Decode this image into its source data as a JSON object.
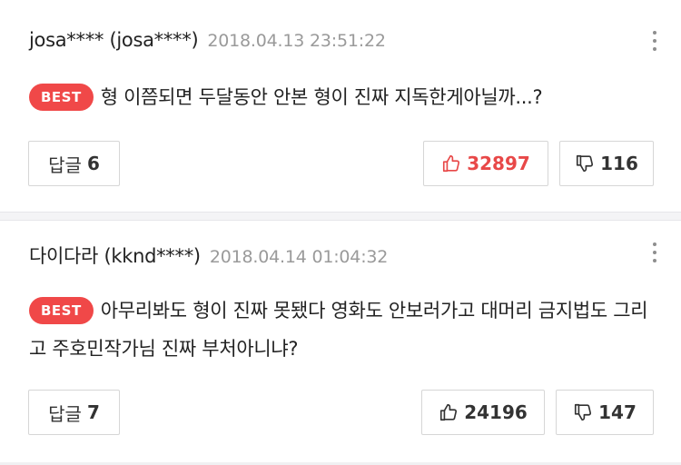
{
  "comments": [
    {
      "author": "josa**** (josa****)",
      "date": "2018.04.13 23:51:22",
      "badge": "BEST",
      "text": "형 이쯤되면 두달동안 안본 형이 진짜 지독한게아닐까...?",
      "reply_label": "답글",
      "reply_count": "6",
      "likes": "32897",
      "dislikes": "116",
      "liked": true,
      "more_icon": "more-vertical-icon"
    },
    {
      "author": "다이다라 (kknd****)",
      "date": "2018.04.14 01:04:32",
      "badge": "BEST",
      "text": "아무리봐도 형이 진짜 못됐다 영화도 안보러가고 대머리 금지법도 그리고 주호민작가님 진짜 부처아니냐?",
      "reply_label": "답글",
      "reply_count": "7",
      "likes": "24196",
      "dislikes": "147",
      "liked": false,
      "more_icon": "more-vertical-icon"
    }
  ],
  "colors": {
    "accent": "#f04848",
    "like_active": "#e84848",
    "muted": "#9a9a9a"
  }
}
